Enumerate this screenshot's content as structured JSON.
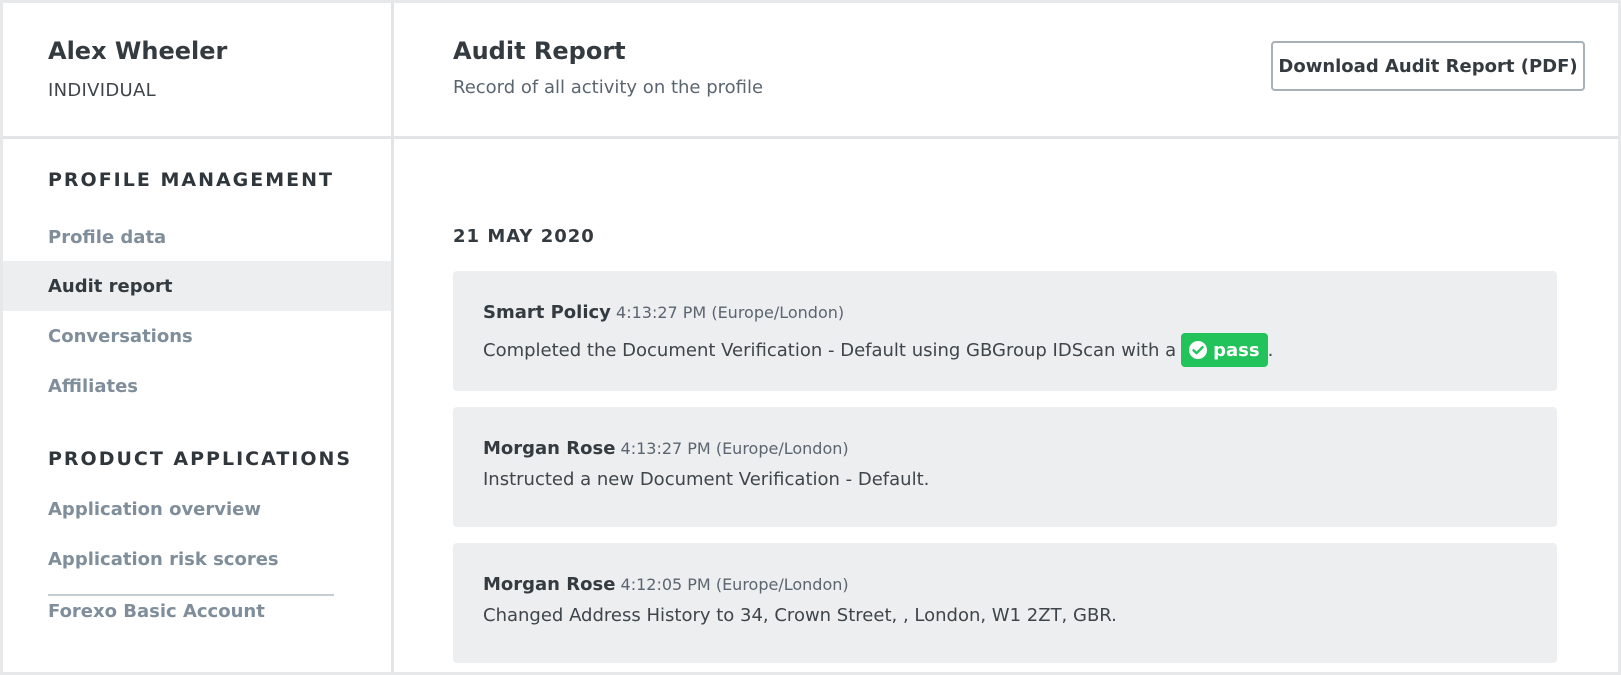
{
  "profile": {
    "name": "Alex Wheeler",
    "type": "INDIVIDUAL"
  },
  "header": {
    "title": "Audit Report",
    "subtitle": "Record of all activity on the profile",
    "download_label": "Download Audit Report (PDF)"
  },
  "sidebar": {
    "profile_section_title": "PROFILE MANAGEMENT",
    "profile_items": [
      {
        "label": "Profile data",
        "active": false
      },
      {
        "label": "Audit report",
        "active": true
      },
      {
        "label": "Conversations",
        "active": false
      },
      {
        "label": "Affiliates",
        "active": false
      }
    ],
    "product_section_title": "PRODUCT APPLICATIONS",
    "product_items": [
      {
        "label": "Application overview"
      },
      {
        "label": "Application risk scores"
      },
      {
        "label": "Forexo Basic Account"
      }
    ]
  },
  "audit": {
    "date": "21 MAY 2020",
    "entries": [
      {
        "actor": "Smart Policy",
        "time": "4:13:27 PM (Europe/London)",
        "text": "Completed the Document Verification - Default using GBGroup IDScan with a",
        "badge": "pass",
        "suffix": "."
      },
      {
        "actor": "Morgan Rose",
        "time": "4:13:27 PM (Europe/London)",
        "text": "Instructed a new Document Verification - Default."
      },
      {
        "actor": "Morgan Rose",
        "time": "4:12:05 PM (Europe/London)",
        "text": "Changed Address History to 34, Crown Street, , London, W1 2ZT, GBR."
      }
    ]
  },
  "colors": {
    "pass_badge": "#22c35a",
    "active_nav_bg": "#eceef0",
    "entry_bg": "#eceef0"
  }
}
